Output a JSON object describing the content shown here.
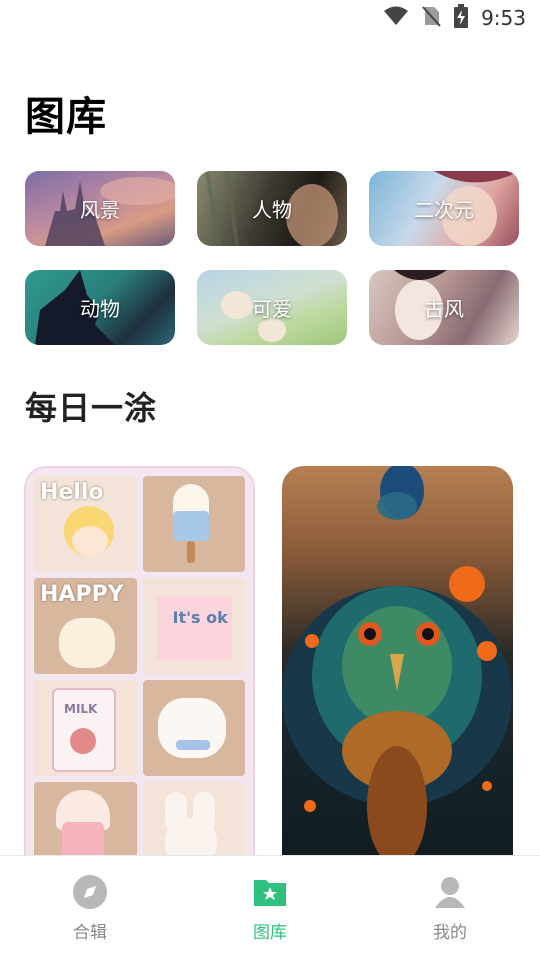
{
  "status": {
    "time": "9:53"
  },
  "page": {
    "title": "图库"
  },
  "categories": [
    {
      "label": "风景"
    },
    {
      "label": "人物"
    },
    {
      "label": "二次元"
    },
    {
      "label": "动物"
    },
    {
      "label": "可爱"
    },
    {
      "label": "古风"
    }
  ],
  "daily": {
    "title": "每日一涂",
    "left_card": {
      "texts": [
        "Hello",
        "HAPPY",
        "It's ok",
        "MILK"
      ]
    }
  },
  "tabs": [
    {
      "label": "合辑",
      "active": false
    },
    {
      "label": "图库",
      "active": true
    },
    {
      "label": "我的",
      "active": false
    }
  ],
  "colors": {
    "accent": "#2fc07f",
    "inactive": "#888888"
  }
}
